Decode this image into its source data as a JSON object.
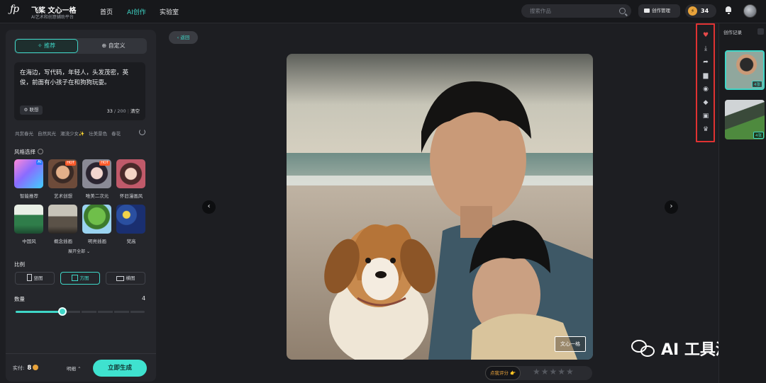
{
  "brand": {
    "mark": "ƒp",
    "name": "飞桨 文心一格",
    "subtitle": "AI艺术和创意辅助平台"
  },
  "nav": [
    {
      "label": "首页"
    },
    {
      "label": "AI创作"
    },
    {
      "label": "实验室"
    }
  ],
  "search": {
    "placeholder": "搜索作品"
  },
  "header": {
    "manage_label": "创作管理",
    "points": "34"
  },
  "mode_tabs": {
    "recommend": "推荐",
    "custom": "自定义"
  },
  "prompt": {
    "text": "在海边，写代码，年轻人，头发茂密，英俊，前面有小孩子在和狗狗玩耍。",
    "associate_label": "联想",
    "count": "33",
    "max": "/ 200",
    "clear": "清空"
  },
  "suggest_tags": [
    "共赏春光",
    "自然风光",
    "潮流少女✨",
    "壮美景色",
    "春花"
  ],
  "style": {
    "label": "风格选择",
    "items": [
      {
        "name": "智能推荐",
        "badge": "AI"
      },
      {
        "name": "艺术创想",
        "badge": "HOT"
      },
      {
        "name": "唯美二次元",
        "badge": "HOT"
      },
      {
        "name": "怀旧漫画风",
        "badge": ""
      },
      {
        "name": "中国风",
        "badge": ""
      },
      {
        "name": "概念插画",
        "badge": ""
      },
      {
        "name": "明亮插画",
        "badge": ""
      },
      {
        "name": "梵高",
        "badge": ""
      }
    ],
    "expand_label": "展开全部"
  },
  "ratio": {
    "label": "比例",
    "options": [
      "竖图",
      "方图",
      "横图"
    ],
    "selected": "方图"
  },
  "quantity": {
    "label": "数量",
    "value": "4",
    "fraction": 0.36
  },
  "footer": {
    "pay_label": "实付:",
    "pay_value": "8",
    "detail_label": "明细",
    "generate_label": "立即生成"
  },
  "back_label": "返回",
  "rating": {
    "label": "点我评分",
    "stars": "★★★★★"
  },
  "watermark": {
    "stamp": "文心一格",
    "text": "AI 工具派"
  },
  "history": {
    "label": "创作记录",
    "items": [
      {
        "count": "4张"
      },
      {
        "count": "4张"
      }
    ]
  },
  "colors": {
    "accent": "#3fd6c7",
    "highlight_border": "#e03232",
    "heart": "#e84a4a"
  }
}
